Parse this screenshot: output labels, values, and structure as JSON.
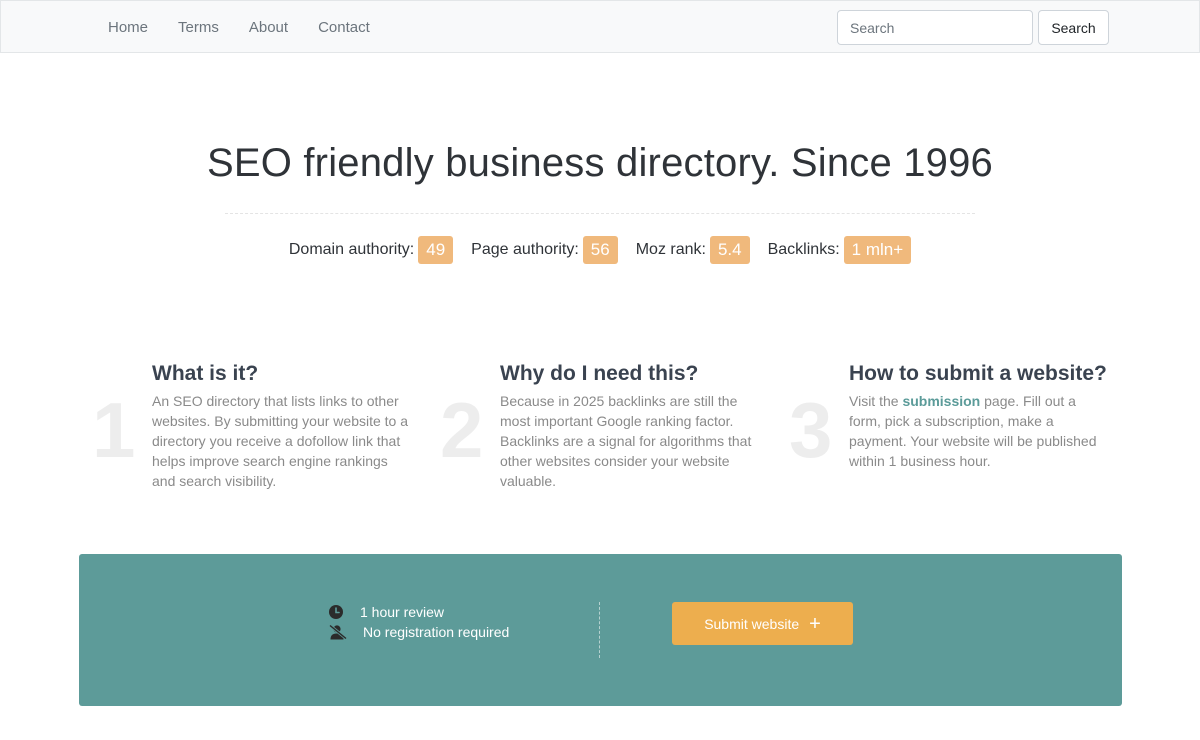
{
  "nav": {
    "links": [
      "Home",
      "Terms",
      "About",
      "Contact"
    ],
    "search_placeholder": "Search",
    "search_button": "Search"
  },
  "hero": {
    "title": "SEO friendly business directory. Since 1996"
  },
  "metrics": [
    {
      "label": "Domain authority:",
      "value": "49"
    },
    {
      "label": "Page authority:",
      "value": "56"
    },
    {
      "label": "Moz rank:",
      "value": "5.4"
    },
    {
      "label": "Backlinks:",
      "value": "1 mln+"
    }
  ],
  "features": [
    {
      "number": "1",
      "title": "What is it?",
      "text": "An SEO directory that lists links to other websites. By submitting your website to a directory you receive a dofollow link that helps improve search engine rankings and search visibility."
    },
    {
      "number": "2",
      "title": "Why do I need this?",
      "text": "Because in 2025 backlinks are still the most important Google ranking factor. Backlinks are a signal for algorithms that other websites consider your website valuable."
    },
    {
      "number": "3",
      "title": "How to submit a website?",
      "text_before": "Visit the",
      "link": "submission",
      "text_after": "page. Fill out a form, pick a subscription, make a payment. Your website will be published within 1 business hour."
    }
  ],
  "cta": {
    "review_text": "1 hour review",
    "review_icon": "clock-icon",
    "registration_text": "No registration required",
    "registration_icon": "user-slash-icon",
    "submit_label": "Submit website",
    "submit_icon": "plus-icon"
  },
  "colors": {
    "accent_badge": "#f0b97c",
    "cta_background": "#5d9b99",
    "submit_button": "#edae4e"
  }
}
